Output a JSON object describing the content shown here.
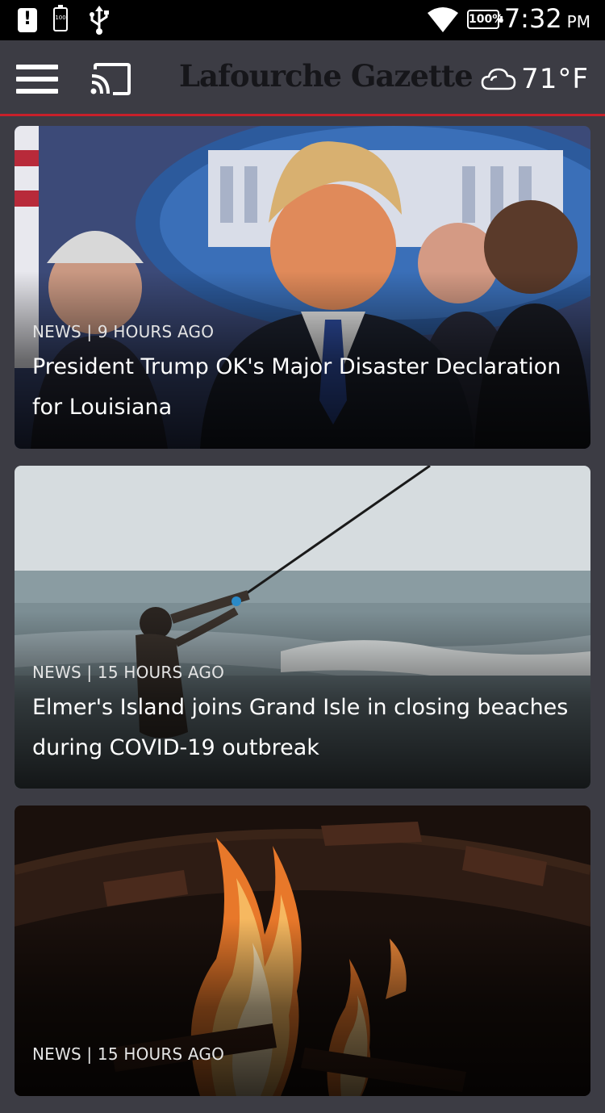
{
  "status_bar": {
    "battery_small_label": "100",
    "battery_percent": "100%",
    "time": "7:32",
    "ampm": "PM"
  },
  "header": {
    "app_title": "Lafourche Gazette",
    "weather_icon": "cloud-icon",
    "temperature": "71°F"
  },
  "feed": {
    "stories": [
      {
        "meta": "NEWS | 9 HOURS AGO",
        "headline": "President Trump OK's Major Disaster Declaration for Louisiana",
        "image": "press-briefing-photo"
      },
      {
        "meta": "NEWS | 15 HOURS AGO",
        "headline": "Elmer's Island joins Grand Isle in closing beaches during COVID-19 outbreak",
        "image": "beach-fishing-photo"
      },
      {
        "meta": "NEWS | 15 HOURS AGO",
        "headline": "",
        "image": "campfire-photo"
      }
    ]
  },
  "colors": {
    "header_bg": "#3c3c44",
    "accent": "#c8202a",
    "status_bar_bg": "#000000"
  }
}
